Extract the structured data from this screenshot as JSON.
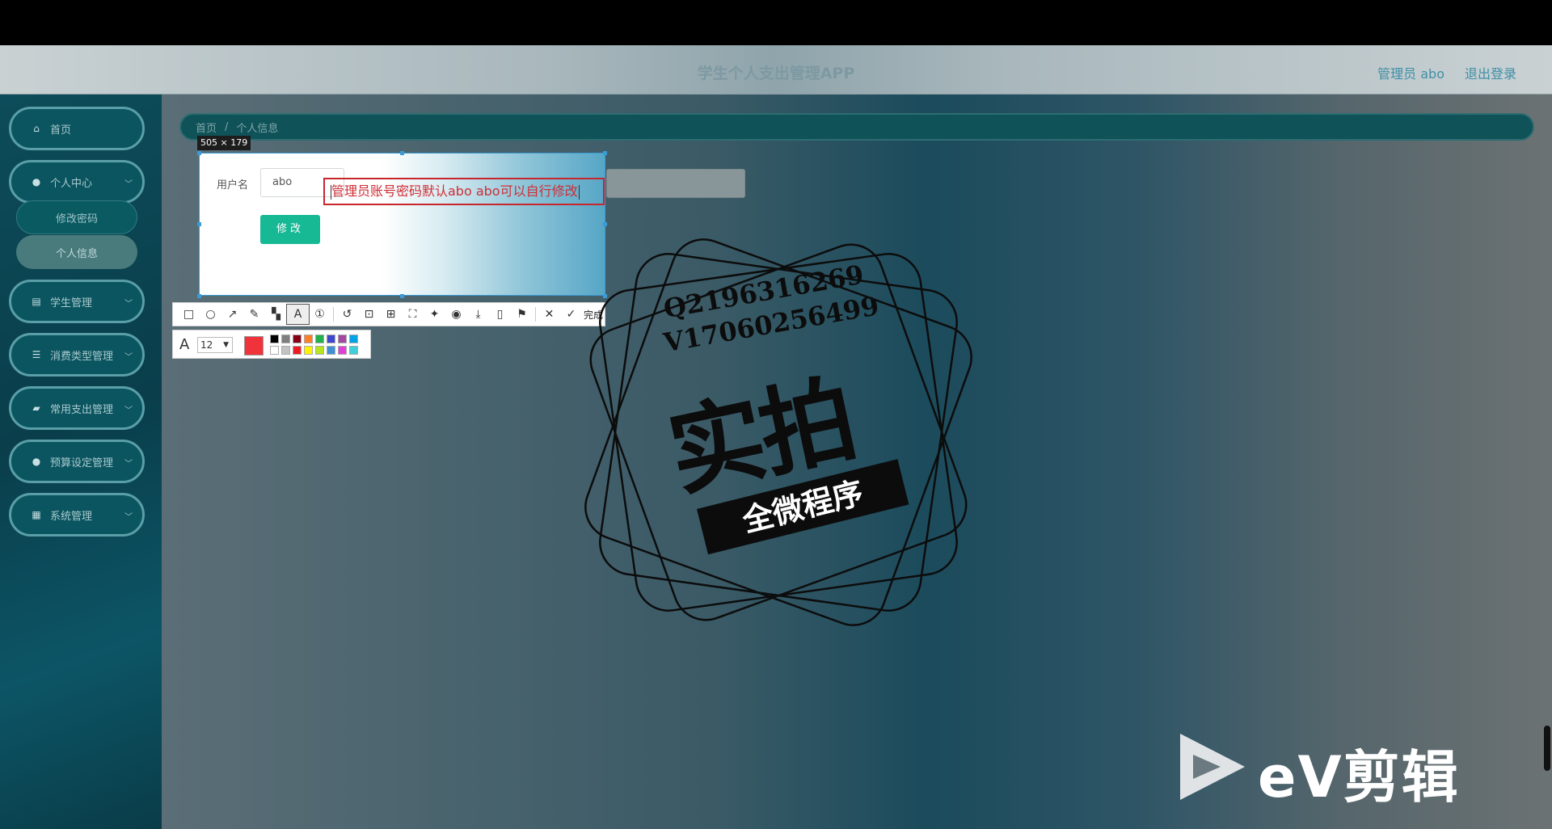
{
  "header": {
    "app_title": "学生个人支出管理APP",
    "admin_label": "管理员 abo",
    "logout_label": "退出登录"
  },
  "sidebar": {
    "items": [
      {
        "label": "首页",
        "icon": "home-icon"
      },
      {
        "label": "个人中心",
        "icon": "user-icon"
      },
      {
        "label": "学生管理",
        "icon": "clipboard-icon"
      },
      {
        "label": "消费类型管理",
        "icon": "list-icon"
      },
      {
        "label": "常用支出管理",
        "icon": "thumbs-up-icon"
      },
      {
        "label": "预算设定管理",
        "icon": "user-icon"
      },
      {
        "label": "系统管理",
        "icon": "grid-icon"
      }
    ],
    "submenu": [
      "修改密码",
      "个人信息"
    ]
  },
  "breadcrumb": {
    "home": "首页",
    "sep": "/",
    "current": "个人信息"
  },
  "form": {
    "username_label": "用户名",
    "username_value": "abo",
    "submit_label": "修改"
  },
  "capture_tool": {
    "selection_size": "505 × 179",
    "annotation_text": "管理员账号密码默认abo abo可以自行修改",
    "done_label": "完成",
    "font_size": "12",
    "current_color": "#f0333a",
    "palette": [
      "#000000",
      "#7f7f7f",
      "#880015",
      "#ff7f27",
      "#22b14c",
      "#3f48cc",
      "#a349a4",
      "#00a2e8",
      "#ffffff",
      "#c3c3c3",
      "#ed1c24",
      "#fff200",
      "#b5e61d",
      "#3f8fd6",
      "#e040d6",
      "#3ed0d8"
    ]
  },
  "watermark": {
    "q_line": "Q2196316269",
    "v_line": "V17060256499",
    "main": "实拍",
    "banner": "全微程序",
    "ev_brand": "eV剪辑"
  }
}
